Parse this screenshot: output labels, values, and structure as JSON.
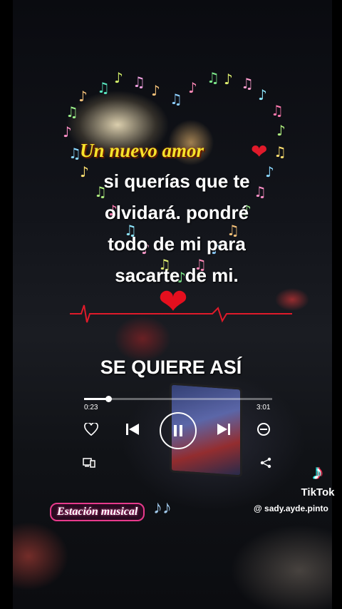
{
  "title": "Un nuevo amor",
  "title_heart": "❤",
  "lyrics": "si querías que te\nolvidará. pondré\ntodo de mi para\nsacarte de mi.",
  "big_heart": "❤",
  "banner": "SE QUIERE ASÍ",
  "player": {
    "elapsed": "0:23",
    "duration": "3:01",
    "progress": 0.13,
    "like_icon": "heart-outline-icon",
    "prev_icon": "skip-back-icon",
    "pause_icon": "pause-icon",
    "next_icon": "skip-forward-icon",
    "remove_icon": "minus-circle-icon",
    "devices_icon": "devices-icon",
    "share_icon": "share-icon"
  },
  "watermark": {
    "brand": "TikTok",
    "handle": "@ sady.ayde.pinto"
  },
  "sticker": "Estación musical",
  "notes": "♪♪",
  "colors": {
    "title": "#f7e32a",
    "heart": "#e50f1e",
    "sticker_border": "#e83a8c"
  }
}
